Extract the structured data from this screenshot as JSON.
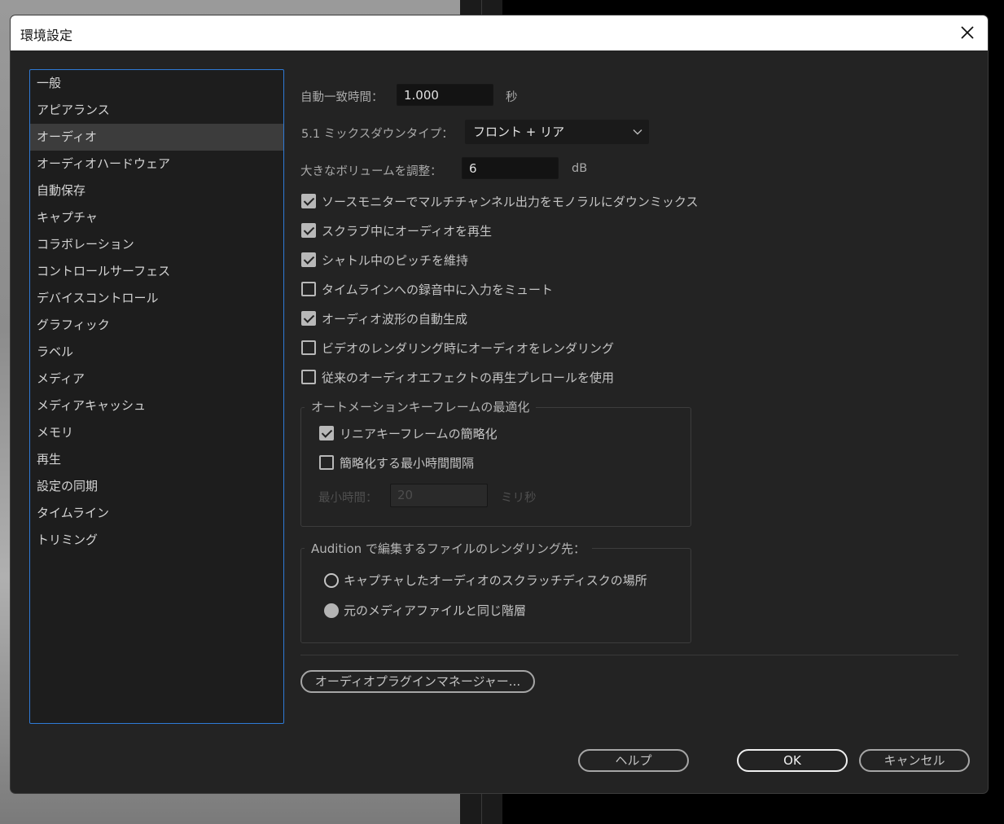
{
  "window": {
    "title": "環境設定"
  },
  "sidebar": {
    "items": [
      {
        "label": "一般"
      },
      {
        "label": "アピアランス"
      },
      {
        "label": "オーディオ",
        "selected": true
      },
      {
        "label": "オーディオハードウェア"
      },
      {
        "label": "自動保存"
      },
      {
        "label": "キャプチャ"
      },
      {
        "label": "コラボレーション"
      },
      {
        "label": "コントロールサーフェス"
      },
      {
        "label": "デバイスコントロール"
      },
      {
        "label": "グラフィック"
      },
      {
        "label": "ラベル"
      },
      {
        "label": "メディア"
      },
      {
        "label": "メディアキャッシュ"
      },
      {
        "label": "メモリ"
      },
      {
        "label": "再生"
      },
      {
        "label": "設定の同期"
      },
      {
        "label": "タイムライン"
      },
      {
        "label": "トリミング"
      }
    ]
  },
  "audio": {
    "auto_match": {
      "label": "自動一致時間：",
      "value": "1.000",
      "unit": "秒"
    },
    "mixdown": {
      "label": "5.1 ミックスダウンタイプ：",
      "value": "フロント + リア"
    },
    "large_volume": {
      "label": "大きなボリュームを調整：",
      "value": "6",
      "unit": "dB"
    },
    "checkboxes": [
      {
        "label": "ソースモニターでマルチチャンネル出力をモノラルにダウンミックス",
        "checked": true
      },
      {
        "label": "スクラブ中にオーディオを再生",
        "checked": true
      },
      {
        "label": "シャトル中のピッチを維持",
        "checked": true
      },
      {
        "label": "タイムラインへの録音中に入力をミュート",
        "checked": false
      },
      {
        "label": "オーディオ波形の自動生成",
        "checked": true
      },
      {
        "label": "ビデオのレンダリング時にオーディオをレンダリング",
        "checked": false
      },
      {
        "label": "従来のオーディオエフェクトの再生プレロールを使用",
        "checked": false
      }
    ],
    "automation": {
      "title": "オートメーションキーフレームの最適化",
      "linear": {
        "label": "リニアキーフレームの簡略化",
        "checked": true
      },
      "min_interval": {
        "label": "簡略化する最小時間間隔",
        "checked": false
      },
      "min_time": {
        "label": "最小時間：",
        "value": "20",
        "unit": "ミリ秒"
      }
    },
    "audition": {
      "title": "Audition で編集するファイルのレンダリング先：",
      "options": [
        {
          "label": "キャプチャしたオーディオのスクラッチディスクの場所",
          "selected": false
        },
        {
          "label": "元のメディアファイルと同じ階層",
          "selected": true
        }
      ]
    },
    "plugin_manager_label": "オーディオプラグインマネージャー..."
  },
  "footer": {
    "help": "ヘルプ",
    "ok": "OK",
    "cancel": "キャンセル"
  }
}
